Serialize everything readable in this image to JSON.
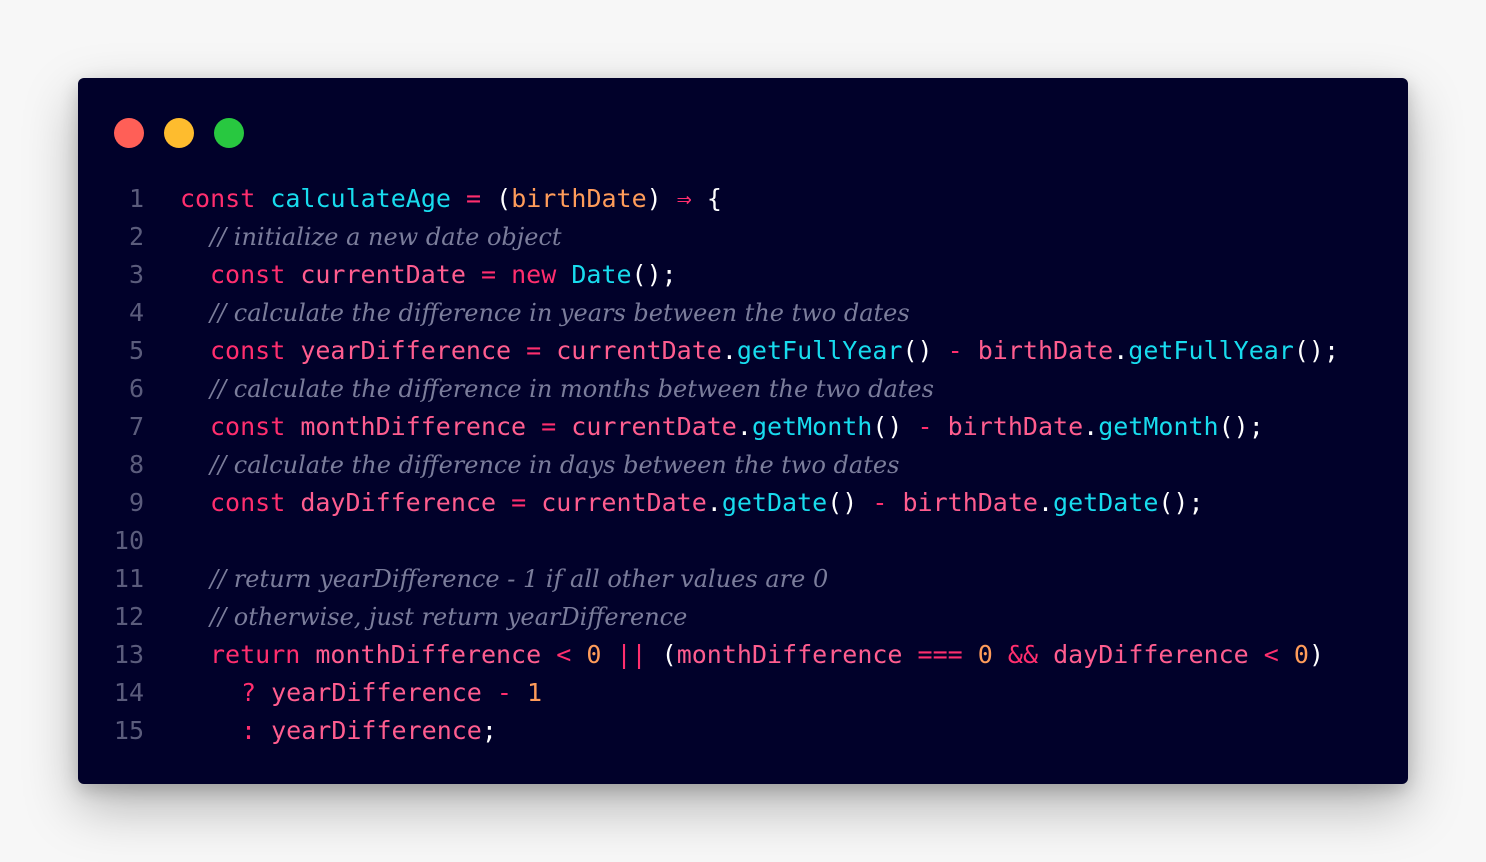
{
  "window": {
    "controls": [
      "close",
      "minimize",
      "maximize"
    ],
    "colors": {
      "background": "#01012a",
      "close": "#ff5f57",
      "minimize": "#febc2e",
      "maximize": "#28c840"
    }
  },
  "code": {
    "lines": [
      {
        "number": "1",
        "tokens": [
          {
            "text": "const",
            "type": "kw"
          },
          {
            "text": " ",
            "type": "punc"
          },
          {
            "text": "calculateAge",
            "type": "fn"
          },
          {
            "text": " ",
            "type": "punc"
          },
          {
            "text": "=",
            "type": "op"
          },
          {
            "text": " ",
            "type": "punc"
          },
          {
            "text": "(",
            "type": "punc"
          },
          {
            "text": "birthDate",
            "type": "param"
          },
          {
            "text": ")",
            "type": "punc"
          },
          {
            "text": " ",
            "type": "punc"
          },
          {
            "text": "⇒",
            "type": "arrow"
          },
          {
            "text": " ",
            "type": "punc"
          },
          {
            "text": "{",
            "type": "punc"
          }
        ],
        "indent": 0
      },
      {
        "number": "2",
        "tokens": [
          {
            "text": "// initialize a new date object",
            "type": "cm"
          }
        ],
        "indent": 1
      },
      {
        "number": "3",
        "tokens": [
          {
            "text": "const",
            "type": "kw"
          },
          {
            "text": " ",
            "type": "punc"
          },
          {
            "text": "currentDate",
            "type": "var"
          },
          {
            "text": " ",
            "type": "punc"
          },
          {
            "text": "=",
            "type": "op"
          },
          {
            "text": " ",
            "type": "punc"
          },
          {
            "text": "new",
            "type": "kw"
          },
          {
            "text": " ",
            "type": "punc"
          },
          {
            "text": "Date",
            "type": "fn"
          },
          {
            "text": "();",
            "type": "punc"
          }
        ],
        "indent": 1
      },
      {
        "number": "4",
        "tokens": [
          {
            "text": "// calculate the difference in years between the two dates",
            "type": "cm"
          }
        ],
        "indent": 1
      },
      {
        "number": "5",
        "tokens": [
          {
            "text": "const",
            "type": "kw"
          },
          {
            "text": " ",
            "type": "punc"
          },
          {
            "text": "yearDifference",
            "type": "var"
          },
          {
            "text": " ",
            "type": "punc"
          },
          {
            "text": "=",
            "type": "op"
          },
          {
            "text": " ",
            "type": "punc"
          },
          {
            "text": "currentDate",
            "type": "var"
          },
          {
            "text": ".",
            "type": "punc"
          },
          {
            "text": "getFullYear",
            "type": "fn"
          },
          {
            "text": "()",
            "type": "punc"
          },
          {
            "text": " ",
            "type": "punc"
          },
          {
            "text": "-",
            "type": "op"
          },
          {
            "text": " ",
            "type": "punc"
          },
          {
            "text": "birthDate",
            "type": "var"
          },
          {
            "text": ".",
            "type": "punc"
          },
          {
            "text": "getFullYear",
            "type": "fn"
          },
          {
            "text": "();",
            "type": "punc"
          }
        ],
        "indent": 1
      },
      {
        "number": "6",
        "tokens": [
          {
            "text": "// calculate the difference in months between the two dates",
            "type": "cm"
          }
        ],
        "indent": 1
      },
      {
        "number": "7",
        "tokens": [
          {
            "text": "const",
            "type": "kw"
          },
          {
            "text": " ",
            "type": "punc"
          },
          {
            "text": "monthDifference",
            "type": "var"
          },
          {
            "text": " ",
            "type": "punc"
          },
          {
            "text": "=",
            "type": "op"
          },
          {
            "text": " ",
            "type": "punc"
          },
          {
            "text": "currentDate",
            "type": "var"
          },
          {
            "text": ".",
            "type": "punc"
          },
          {
            "text": "getMonth",
            "type": "fn"
          },
          {
            "text": "()",
            "type": "punc"
          },
          {
            "text": " ",
            "type": "punc"
          },
          {
            "text": "-",
            "type": "op"
          },
          {
            "text": " ",
            "type": "punc"
          },
          {
            "text": "birthDate",
            "type": "var"
          },
          {
            "text": ".",
            "type": "punc"
          },
          {
            "text": "getMonth",
            "type": "fn"
          },
          {
            "text": "();",
            "type": "punc"
          }
        ],
        "indent": 1
      },
      {
        "number": "8",
        "tokens": [
          {
            "text": "// calculate the difference in days between the two dates",
            "type": "cm"
          }
        ],
        "indent": 1
      },
      {
        "number": "9",
        "tokens": [
          {
            "text": "const",
            "type": "kw"
          },
          {
            "text": " ",
            "type": "punc"
          },
          {
            "text": "dayDifference",
            "type": "var"
          },
          {
            "text": " ",
            "type": "punc"
          },
          {
            "text": "=",
            "type": "op"
          },
          {
            "text": " ",
            "type": "punc"
          },
          {
            "text": "currentDate",
            "type": "var"
          },
          {
            "text": ".",
            "type": "punc"
          },
          {
            "text": "getDate",
            "type": "fn"
          },
          {
            "text": "()",
            "type": "punc"
          },
          {
            "text": " ",
            "type": "punc"
          },
          {
            "text": "-",
            "type": "op"
          },
          {
            "text": " ",
            "type": "punc"
          },
          {
            "text": "birthDate",
            "type": "var"
          },
          {
            "text": ".",
            "type": "punc"
          },
          {
            "text": "getDate",
            "type": "fn"
          },
          {
            "text": "();",
            "type": "punc"
          }
        ],
        "indent": 1
      },
      {
        "number": "10",
        "tokens": [],
        "indent": 0
      },
      {
        "number": "11",
        "tokens": [
          {
            "text": "// return yearDifference - 1 if all other values are 0",
            "type": "cm"
          }
        ],
        "indent": 1
      },
      {
        "number": "12",
        "tokens": [
          {
            "text": "// otherwise, just return yearDifference",
            "type": "cm"
          }
        ],
        "indent": 1
      },
      {
        "number": "13",
        "tokens": [
          {
            "text": "return",
            "type": "kw"
          },
          {
            "text": " ",
            "type": "punc"
          },
          {
            "text": "monthDifference",
            "type": "var"
          },
          {
            "text": " ",
            "type": "punc"
          },
          {
            "text": "<",
            "type": "op"
          },
          {
            "text": " ",
            "type": "punc"
          },
          {
            "text": "0",
            "type": "num"
          },
          {
            "text": " ",
            "type": "punc"
          },
          {
            "text": "||",
            "type": "op"
          },
          {
            "text": " ",
            "type": "punc"
          },
          {
            "text": "(",
            "type": "punc"
          },
          {
            "text": "monthDifference",
            "type": "var"
          },
          {
            "text": " ",
            "type": "punc"
          },
          {
            "text": "===",
            "type": "op"
          },
          {
            "text": " ",
            "type": "punc"
          },
          {
            "text": "0",
            "type": "num"
          },
          {
            "text": " ",
            "type": "punc"
          },
          {
            "text": "&&",
            "type": "op"
          },
          {
            "text": " ",
            "type": "punc"
          },
          {
            "text": "dayDifference",
            "type": "var"
          },
          {
            "text": " ",
            "type": "punc"
          },
          {
            "text": "<",
            "type": "op"
          },
          {
            "text": " ",
            "type": "punc"
          },
          {
            "text": "0",
            "type": "num"
          },
          {
            "text": ")",
            "type": "punc"
          }
        ],
        "indent": 1
      },
      {
        "number": "14",
        "tokens": [
          {
            "text": "?",
            "type": "op"
          },
          {
            "text": " ",
            "type": "punc"
          },
          {
            "text": "yearDifference",
            "type": "var"
          },
          {
            "text": " ",
            "type": "punc"
          },
          {
            "text": "-",
            "type": "op"
          },
          {
            "text": " ",
            "type": "punc"
          },
          {
            "text": "1",
            "type": "num"
          }
        ],
        "indent": 2
      },
      {
        "number": "15",
        "tokens": [
          {
            "text": ":",
            "type": "op"
          },
          {
            "text": " ",
            "type": "punc"
          },
          {
            "text": "yearDifference",
            "type": "var"
          },
          {
            "text": ";",
            "type": "punc"
          }
        ],
        "indent": 2
      }
    ]
  }
}
